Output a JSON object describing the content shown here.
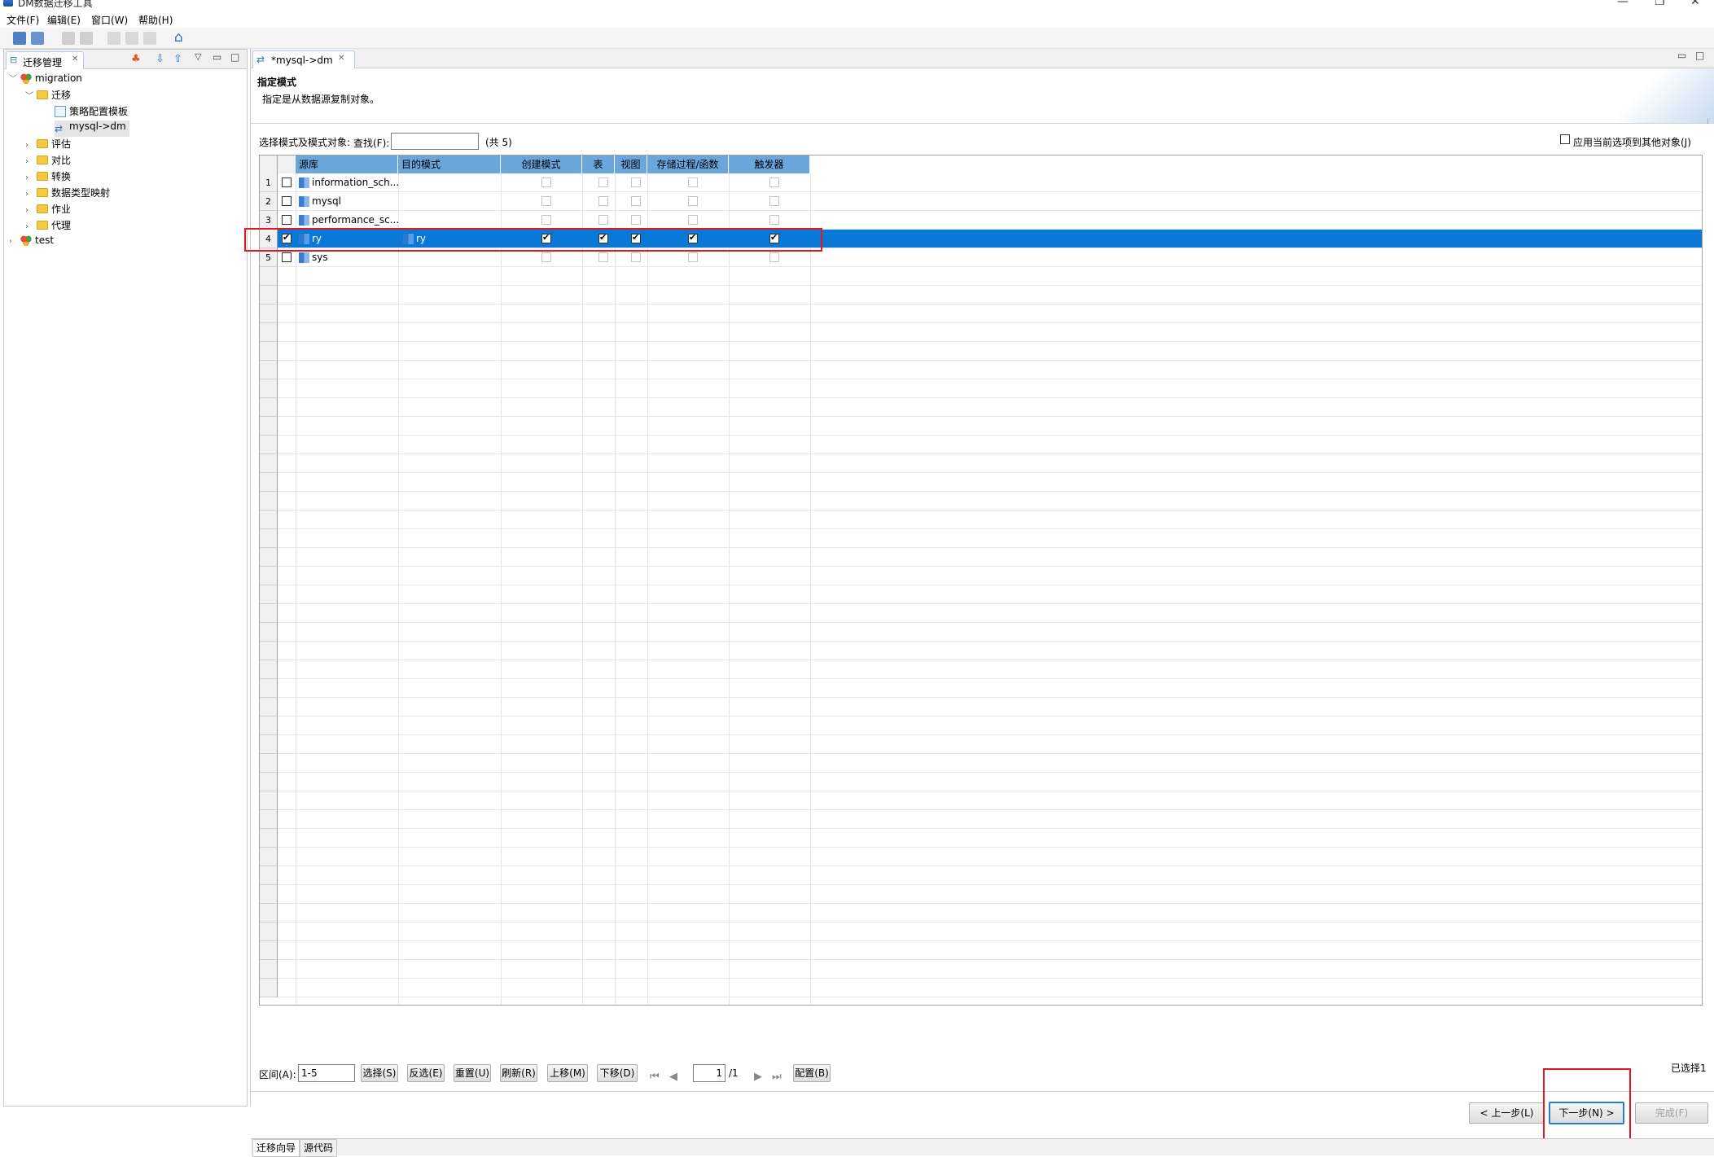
{
  "window": {
    "title": "DM数据迁移工具"
  },
  "menu": [
    "文件(F)",
    "编辑(E)",
    "窗口(W)",
    "帮助(H)"
  ],
  "left_panel": {
    "tab_label": "迁移管理",
    "tree": {
      "root": "migration",
      "migrate_folder": "迁移",
      "template": "策略配置模板",
      "selected_item": "mysql->dm",
      "folders": [
        "评估",
        "对比",
        "转换",
        "数据类型映射",
        "作业",
        "代理"
      ],
      "test": "test"
    }
  },
  "editor": {
    "tab_label": "*mysql->dm",
    "header_title": "指定模式",
    "header_desc": "指定是从数据源复制对象。",
    "filter_label": "选择模式及模式对象:",
    "search_label": "查找(F):",
    "search_value": "",
    "total": "(共 5)",
    "apply_other_label": "应用当前选项到其他对象(J)",
    "columns": [
      "源库",
      "目的模式",
      "创建模式",
      "表",
      "视图",
      "存储过程/函数",
      "触发器"
    ],
    "rows": [
      {
        "num": "1",
        "source": "information_sch...",
        "target": "",
        "checked": false
      },
      {
        "num": "2",
        "source": "mysql",
        "target": "",
        "checked": false
      },
      {
        "num": "3",
        "source": "performance_sc...",
        "target": "",
        "checked": false
      },
      {
        "num": "4",
        "source": "ry",
        "target": "ry",
        "checked": true
      },
      {
        "num": "5",
        "source": "sys",
        "target": "",
        "checked": false
      }
    ],
    "range_label": "区间(A):",
    "range_value": "1-5",
    "buttons": [
      "选择(S)",
      "反选(E)",
      "重置(U)",
      "刷新(R)",
      "上移(M)",
      "下移(D)"
    ],
    "page_value": "1",
    "page_total": "/1",
    "config_button": "配置(B)",
    "selected_count": "已选择1",
    "prev_button": "< 上一步(L)",
    "next_button": "下一步(N) >",
    "finish_button": "完成(F)",
    "bottom_tabs": [
      "迁移向导",
      "源代码"
    ]
  }
}
